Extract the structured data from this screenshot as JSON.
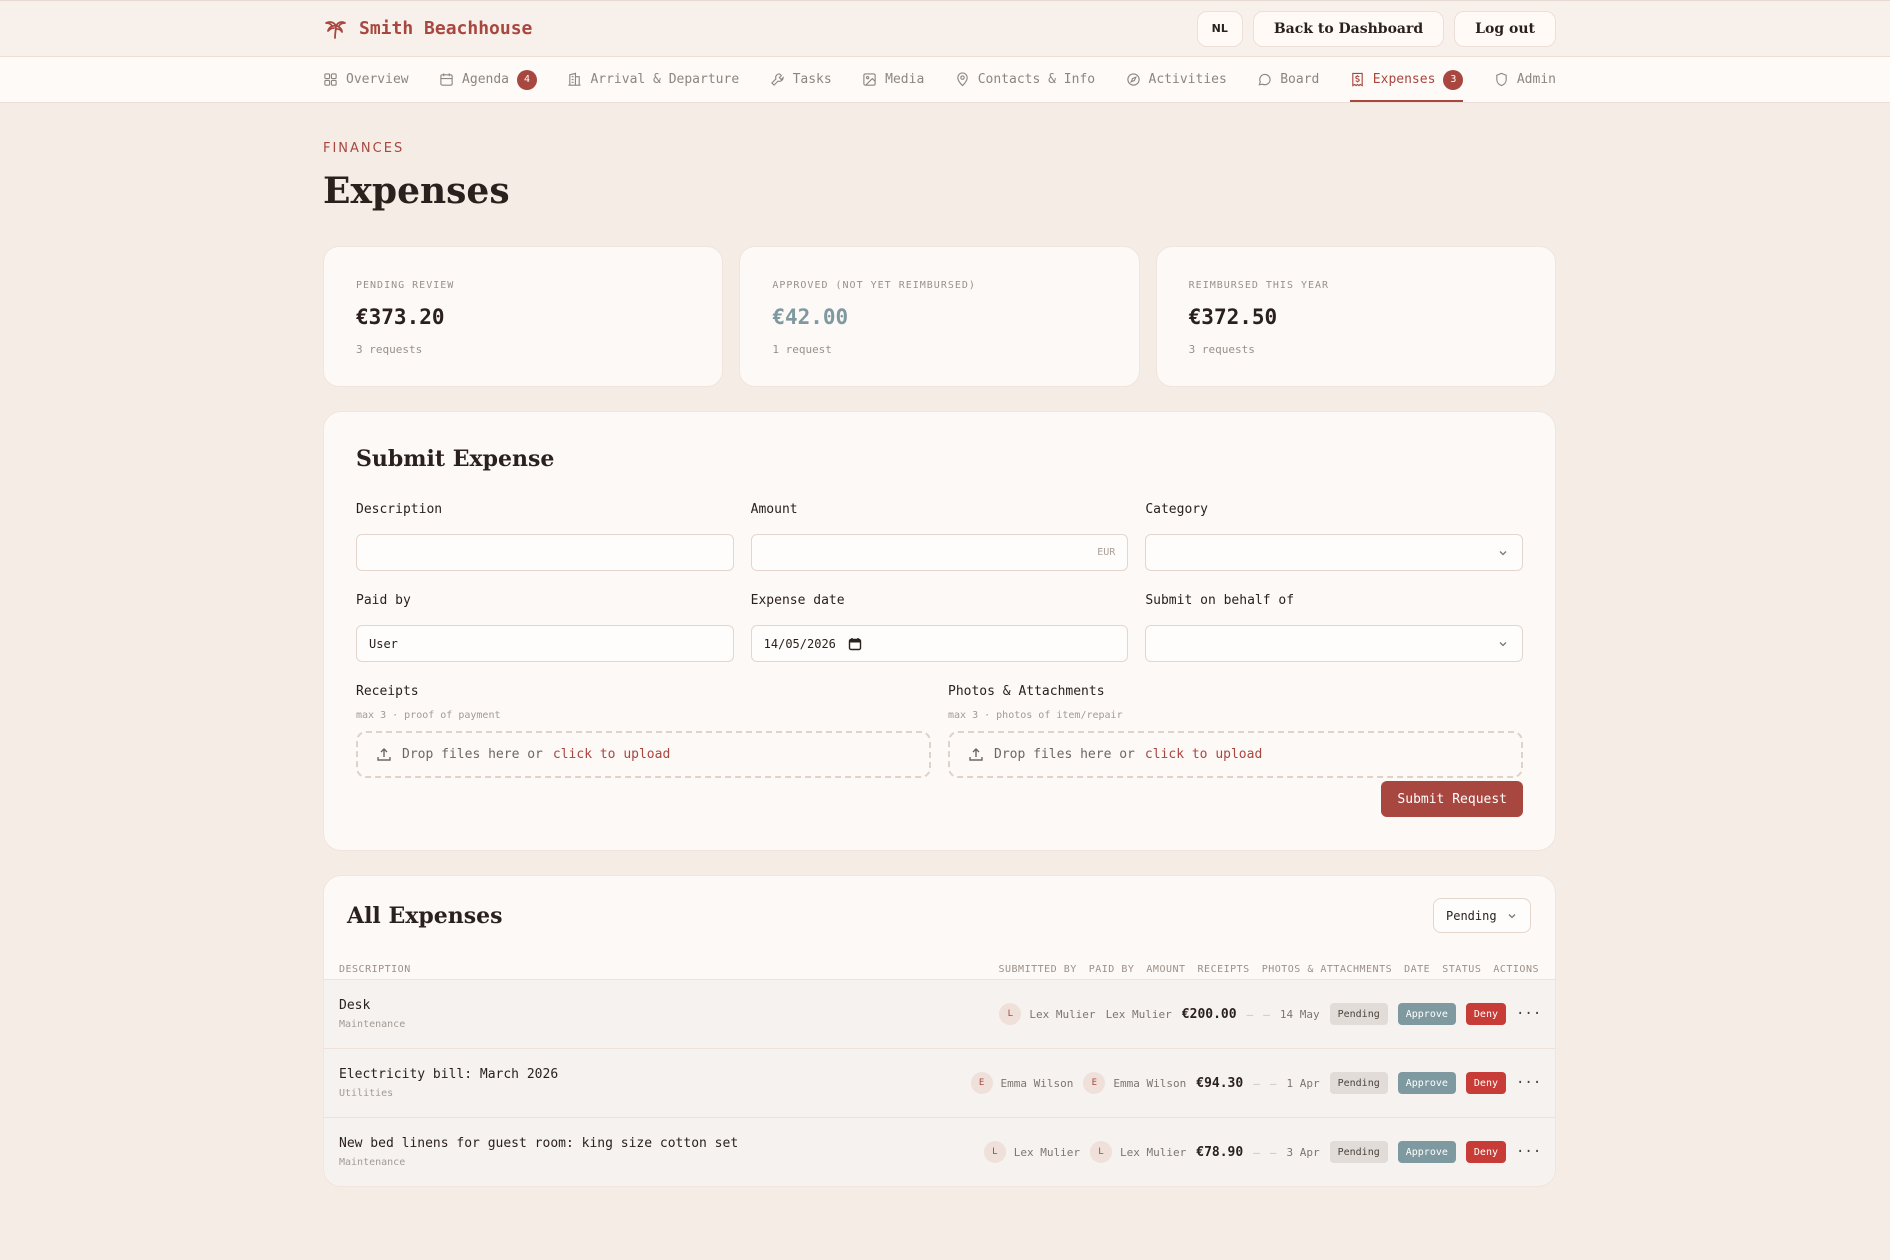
{
  "header": {
    "brand": "Smith Beachhouse",
    "lang": "NL",
    "back_label": "Back to Dashboard",
    "logout_label": "Log out"
  },
  "nav": [
    {
      "label": "Overview",
      "icon": "grid-icon"
    },
    {
      "label": "Agenda",
      "icon": "calendar-icon",
      "badge": "4"
    },
    {
      "label": "Arrival & Departure",
      "icon": "building-icon"
    },
    {
      "label": "Tasks",
      "icon": "wrench-icon"
    },
    {
      "label": "Media",
      "icon": "image-icon"
    },
    {
      "label": "Contacts & Info",
      "icon": "pin-icon"
    },
    {
      "label": "Activities",
      "icon": "compass-icon"
    },
    {
      "label": "Board",
      "icon": "chat-icon"
    },
    {
      "label": "Expenses",
      "icon": "receipt-icon",
      "badge": "3",
      "active": true
    },
    {
      "label": "Admin",
      "icon": "shield-icon"
    }
  ],
  "page": {
    "eyebrow": "FINANCES",
    "title": "Expenses"
  },
  "stats": [
    {
      "label": "PENDING REVIEW",
      "value": "€373.20",
      "sub": "3 requests"
    },
    {
      "label": "APPROVED (NOT YET REIMBURSED)",
      "value": "€42.00",
      "sub": "1 request"
    },
    {
      "label": "REIMBURSED THIS YEAR",
      "value": "€372.50",
      "sub": "3 requests"
    }
  ],
  "form": {
    "title": "Submit Expense",
    "description_label": "Description",
    "description_value": "",
    "amount_label": "Amount",
    "amount_value": "",
    "amount_suffix": "EUR",
    "category_label": "Category",
    "category_value": "",
    "paid_by_label": "Paid by",
    "paid_by_value": "User",
    "date_label": "Expense date",
    "date_value": "14/05/2026",
    "behalf_label": "Submit on behalf of",
    "behalf_value": "",
    "receipts_label": "Receipts",
    "receipts_hint": "max 3 · proof of payment",
    "photos_label": "Photos & Attachments",
    "photos_hint": "max 3 · photos of item/repair",
    "drop_text": "Drop files here or",
    "drop_link": "click to upload",
    "submit_label": "Submit Request"
  },
  "table": {
    "title": "All Expenses",
    "filter_value": "Pending",
    "col_description": "DESCRIPTION",
    "cols_right": [
      "SUBMITTED BY",
      "PAID BY",
      "AMOUNT",
      "RECEIPTS",
      "PHOTOS & ATTACHMENTS",
      "DATE",
      "STATUS",
      "ACTIONS"
    ],
    "dash": "–",
    "approve_label": "Approve",
    "deny_label": "Deny",
    "more_label": "···",
    "rows": [
      {
        "description": "Desk",
        "category": "Maintenance",
        "submitted_by": "Lex Mulier",
        "submitted_initial": "L",
        "paid_by": "Lex Mulier",
        "paid_initial": "",
        "amount": "€200.00",
        "date": "14 May",
        "status": "Pending"
      },
      {
        "description": "Electricity bill: March 2026",
        "category": "Utilities",
        "submitted_by": "Emma Wilson",
        "submitted_initial": "E",
        "paid_by": "Emma Wilson",
        "paid_initial": "E",
        "amount": "€94.30",
        "date": "1 Apr",
        "status": "Pending"
      },
      {
        "description": "New bed linens for guest room: king size cotton set",
        "category": "Maintenance",
        "submitted_by": "Lex Mulier",
        "submitted_initial": "L",
        "paid_by": "Lex Mulier",
        "paid_initial": "L",
        "amount": "€78.90",
        "date": "3 Apr",
        "status": "Pending"
      }
    ]
  },
  "colors": {
    "accent": "#a8473f",
    "background": "#f6ece6",
    "approve": "#7e9aa0",
    "deny": "#c73c36"
  }
}
